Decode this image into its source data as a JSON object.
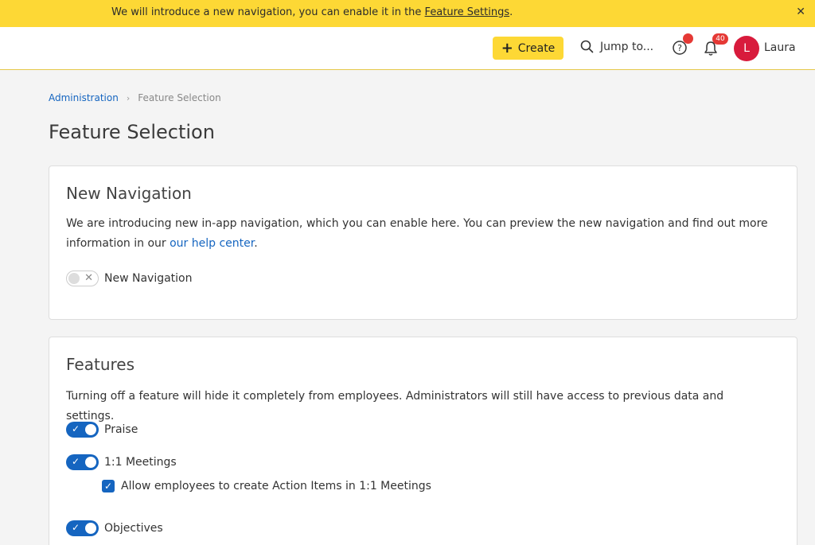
{
  "banner": {
    "text": "We will introduce a new navigation, you can enable it in the ",
    "link": "Feature Settings",
    "suffix": ".",
    "close": "✕"
  },
  "topbar": {
    "create_label": "Create",
    "jump_label": "Jump to...",
    "notifications_count": "40",
    "avatar_initial": "L",
    "user_name": "Laura"
  },
  "breadcrumb": {
    "parent": "Administration",
    "current": "Feature Selection"
  },
  "page_title": "Feature Selection",
  "new_navigation": {
    "title": "New Navigation",
    "desc": "We are introducing new in-app navigation, which you can enable here. You can preview the new navigation and find out more information in our ",
    "link": "our help center",
    "desc_end": ".",
    "toggle_label": "New Navigation",
    "enabled": false
  },
  "features": {
    "title": "Features",
    "desc": "Turning off a feature will hide it completely from employees. Administrators will still have access to previous data and settings.",
    "items": [
      {
        "label": "Praise",
        "enabled": true
      },
      {
        "label": "1:1 Meetings",
        "enabled": true
      },
      {
        "label": "Objectives",
        "enabled": true
      }
    ],
    "sub_option": {
      "label": "Allow employees to create Action Items in 1:1 Meetings",
      "checked": true
    }
  },
  "colors": {
    "banner": "#fdd835",
    "accent": "#1565c0",
    "badge": "#e53935",
    "avatar": "#d81b3c"
  }
}
